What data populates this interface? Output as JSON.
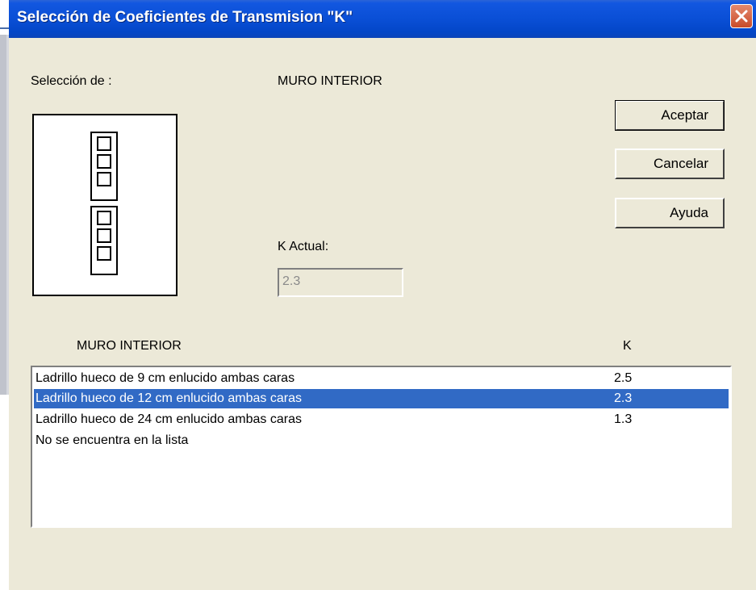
{
  "window": {
    "title": "Selección de Coeficientes de Transmision \"K\""
  },
  "selection": {
    "label": "Selección de :",
    "type": "MURO INTERIOR"
  },
  "buttons": {
    "accept": "Aceptar",
    "cancel": "Cancelar",
    "help": "Ayuda"
  },
  "k_actual": {
    "label": "K Actual:",
    "value": "2.3"
  },
  "list": {
    "header_name": "MURO INTERIOR",
    "header_k": "K",
    "selected_index": 1,
    "rows": [
      {
        "name": "Ladrillo hueco de 9 cm enlucido ambas caras",
        "k": "2.5"
      },
      {
        "name": "Ladrillo hueco de 12 cm enlucido ambas caras",
        "k": "2.3"
      },
      {
        "name": "Ladrillo hueco de 24 cm enlucido ambas caras",
        "k": "1.3"
      },
      {
        "name": "No se encuentra en la lista",
        "k": ""
      }
    ]
  },
  "colors": {
    "titlebar": "#0a4fd6",
    "selection": "#316ac5",
    "dialog_bg": "#ece9d8",
    "close_button": "#c84b2a"
  }
}
